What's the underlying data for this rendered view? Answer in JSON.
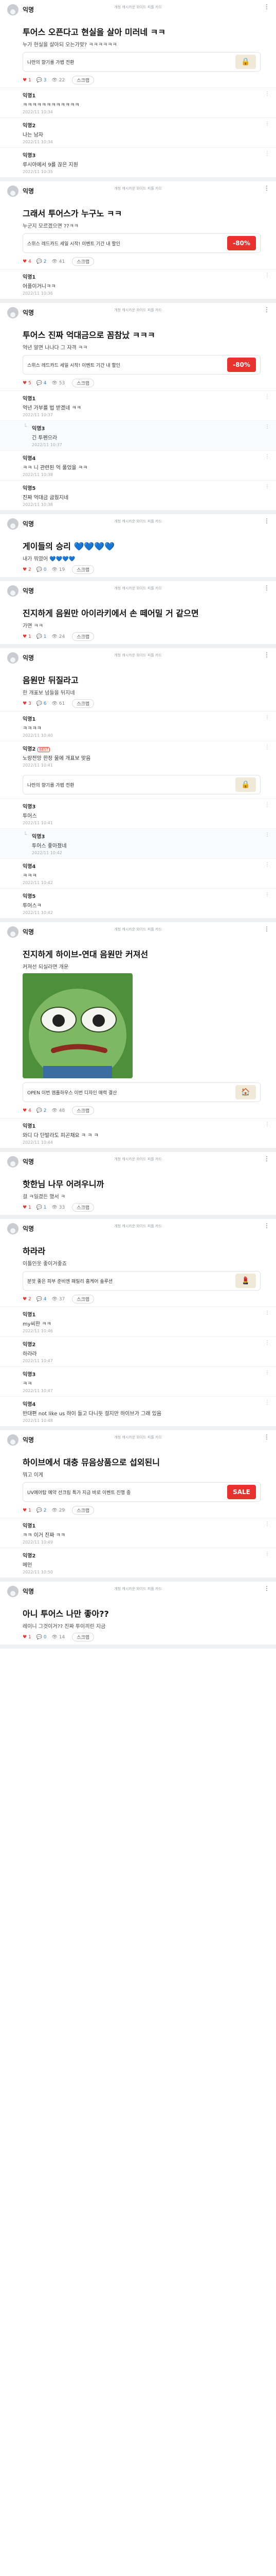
{
  "watermark": "개청 캐시카운\n와이드 피플 카드",
  "posts": [
    {
      "author": "익명",
      "title": "투어스 오픈다고 현실을 살아 미러네 ㅋㅋ",
      "sub": "누가 현실을 살아되 오는가맞? ㅋㅋㅋㅋㅋㅋ",
      "ad": {
        "text": "나만의 향기를 가볍 전환",
        "thumb": "🔒"
      },
      "stats": {
        "likes": "1",
        "comments": "3",
        "views": "22"
      },
      "comments": [
        {
          "author": "익명1",
          "text": "ㅋㅋㅋㅋㅋㅋㅋㅋㅋㅋㅋㅋ",
          "date": "2022/11 10:34",
          "reply": false
        },
        {
          "author": "익명2",
          "text": "나는 남자",
          "date": "2022/11 10:34",
          "reply": false
        },
        {
          "author": "익명3",
          "text": "루시아에서 9를 끊은 지원",
          "date": "2022/11 10:35",
          "reply": false
        }
      ]
    },
    {
      "author": "익명",
      "title": "그래서 투어스가 누구노 ㅋㅋ",
      "sub": "누군지 모르겠으면 ??ㅋㅋ",
      "ad": {
        "text": "스위스 레드카드 세일 시작! 이벤트 기간 내 할인",
        "thumb": "-80%",
        "red": true
      },
      "stats": {
        "likes": "4",
        "comments": "2",
        "views": "41"
      },
      "comments": [
        {
          "author": "익명1",
          "text": "어플이거니ㅋㅋ",
          "date": "2022/11 10:36",
          "reply": false
        }
      ]
    },
    {
      "author": "익명",
      "title": "투어스 진짜 억대금으로 꼼참났 ㅋㅋㅋ",
      "sub": "억년 알면 나나다 그 자격 ㅋㅋ",
      "ad": {
        "text": "스위스 레드카드 세일 시작! 이벤트 기간 내 할인",
        "thumb": "-80%",
        "red": true
      },
      "stats": {
        "likes": "5",
        "comments": "4",
        "views": "53"
      },
      "comments": [
        {
          "author": "익명1",
          "text": "억년 가부를 법 받겠네 ㅋㅋ",
          "date": "2022/11 10:37",
          "reply": false
        },
        {
          "author": "익명3",
          "text": "긴 투펜으라",
          "date": "2022/11 10:37",
          "reply": true
        },
        {
          "author": "익명4",
          "text": "ㅋㅋ 니 관련된 억 풀었을 ㅋㅋ",
          "date": "2022/11 10:38",
          "reply": false
        },
        {
          "author": "익명5",
          "text": "진짜 억대금 굽웠지네",
          "date": "2022/11 10:38",
          "reply": false
        }
      ]
    },
    {
      "author": "익명",
      "title": "게이들의 승리 💙💙💙💙",
      "sub": "내가 뭐였어 💙💙💙💙",
      "stats": {
        "likes": "2",
        "comments": "0",
        "views": "19"
      },
      "comments": []
    },
    {
      "author": "익명",
      "title": "진지하게 음원만 아이라키에서 손 떼어밀 거 같으면",
      "sub": "가면 ㅋㅋ",
      "stats": {
        "likes": "1",
        "comments": "1",
        "views": "24"
      },
      "comments": []
    },
    {
      "author": "익명",
      "title": "음원만 뒤질라고",
      "sub": "한 개표보 넘들을 뒤지네",
      "stats": {
        "likes": "3",
        "comments": "6",
        "views": "61"
      },
      "comments": [
        {
          "author": "익명1",
          "text": "ㅋㅋㅋㅋ",
          "date": "2022/11 10:40",
          "reply": false
        },
        {
          "author": "익명2",
          "text": "노랑전망 한정 물에 개표보 맞음",
          "date": "2022/11 10:41",
          "reply": false,
          "best": "BEST"
        },
        {
          "author": "익명3",
          "text": "투어스",
          "date": "2022/11 10:41",
          "reply": false
        },
        {
          "author": "익명3",
          "text": "투어스 좋아졌네",
          "date": "2022/11 10:42",
          "reply": true
        },
        {
          "author": "익명4",
          "text": "ㅋㅋㅋ",
          "date": "2022/11 10:42",
          "reply": false
        },
        {
          "author": "익명5",
          "text": "투어스ㅋ",
          "date": "2022/11 10:42",
          "reply": false
        }
      ],
      "ad_mid": {
        "text": "나만의 향기를 가볍 전환",
        "thumb": "🔒"
      }
    },
    {
      "author": "익명",
      "title": "진지하게 하이브-연대 음원만 커져선",
      "sub": "커져선 되실라면 개운",
      "pepe": true,
      "stats": {
        "likes": "4",
        "comments": "2",
        "views": "48"
      },
      "ad": {
        "text": "OPEN 이번 엠플하우스 이번 디자인 매력 결산",
        "thumb": "🏠"
      },
      "comments": [
        {
          "author": "익명1",
          "text": "와디 다 단발라도 피곤채요 ㅋ ㅋ ㅋ",
          "date": "2022/11 10:44",
          "reply": false
        }
      ]
    },
    {
      "author": "익명",
      "title": "핫한님 나무 어려우니까",
      "sub": "걸 ㅋ일겼든 했서 ㅋ",
      "stats": {
        "likes": "1",
        "comments": "1",
        "views": "33"
      },
      "comments": []
    },
    {
      "author": "익명",
      "title": "하라라",
      "sub": "이틀인웃 좋이거좋죠",
      "ad": {
        "text": "분앗 좋은 피부 준비엔 패밀리 홈케어 솔루션",
        "thumb": "💄"
      },
      "stats": {
        "likes": "2",
        "comments": "4",
        "views": "37"
      },
      "comments": [
        {
          "author": "익명1",
          "text": "my씨한 ㅋㅋ",
          "date": "2022/11 10:46",
          "reply": false
        },
        {
          "author": "익명2",
          "text": "하라라",
          "date": "2022/11 10:47",
          "reply": false
        },
        {
          "author": "익명3",
          "text": "ㅋㅋ",
          "date": "2022/11 10:47",
          "reply": false
        },
        {
          "author": "익명4",
          "text": "반대편 not like us 하이 들고 다니듯 걸지만 하이브가 그래 있음",
          "date": "2022/11 10:48",
          "reply": false
        }
      ]
    },
    {
      "author": "익명",
      "title": "하이브에서 대충 뮤음상품으로 섭외된니",
      "sub": "뭐고 이게",
      "ad": {
        "text": "UV에어탑 예약 선크림 특가 지금 바로 이벤트 진행 중",
        "thumb": "SALE",
        "red": true
      },
      "stats": {
        "likes": "1",
        "comments": "2",
        "views": "29"
      },
      "comments": [
        {
          "author": "익명1",
          "text": "ㅋㅋ 이거 진짜 ㅋㅋ",
          "date": "2022/11 10:49",
          "reply": false
        },
        {
          "author": "익명2",
          "text": "메인",
          "date": "2022/11 10:50",
          "reply": false
        }
      ]
    },
    {
      "author": "익명",
      "title": "아니 투어스 나만 좋아??",
      "sub": "레이니 그것이거?? 진짜 투이끼린 지금",
      "stats": {
        "likes": "1",
        "comments": "0",
        "views": "14"
      },
      "comments": []
    }
  ],
  "labels": {
    "scrap": "스크랩",
    "more": "⋮"
  }
}
